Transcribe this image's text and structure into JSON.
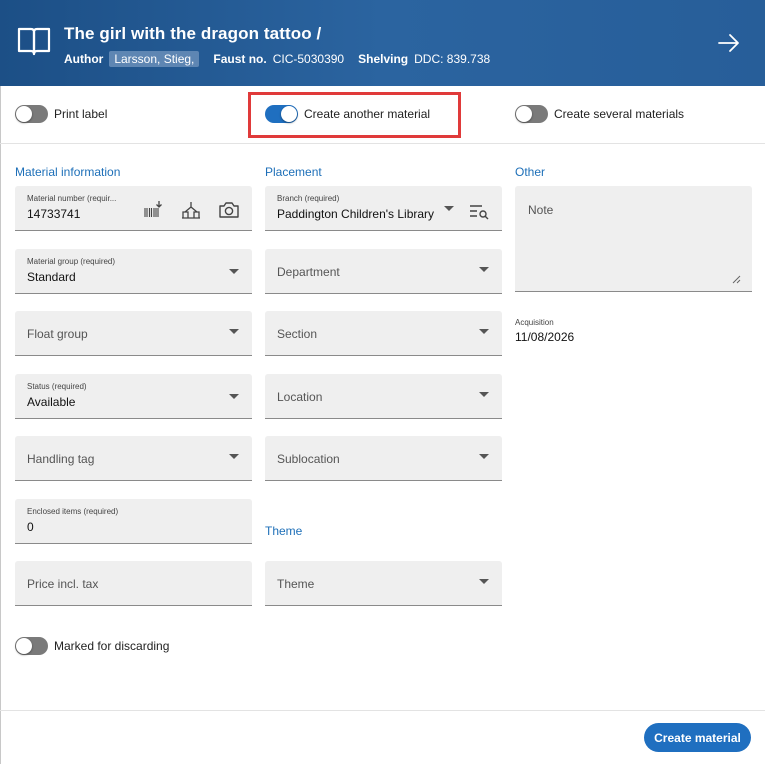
{
  "header": {
    "title": "The girl with the dragon tattoo /",
    "author_label": "Author",
    "author_value": "Larsson, Stieg,",
    "faust_label": "Faust no.",
    "faust_value": "CIC-5030390",
    "shelving_label": "Shelving",
    "shelving_value": "DDC: 839.738"
  },
  "toggles": {
    "print_label": "Print label",
    "create_another": "Create another material",
    "create_several": "Create several materials",
    "marked_discarding": "Marked for discarding"
  },
  "sections": {
    "material_info": "Material information",
    "placement": "Placement",
    "other": "Other",
    "theme": "Theme"
  },
  "fields": {
    "material_number": {
      "label": "Material number (requir...",
      "value": "14733741"
    },
    "material_group": {
      "label": "Material group (required)",
      "value": "Standard"
    },
    "float_group": {
      "placeholder": "Float group"
    },
    "status": {
      "label": "Status (required)",
      "value": "Available"
    },
    "handling_tag": {
      "placeholder": "Handling tag"
    },
    "enclosed_items": {
      "label": "Enclosed items (required)",
      "value": "0"
    },
    "price": {
      "placeholder": "Price incl. tax"
    },
    "branch": {
      "label": "Branch (required)",
      "value": "Paddington Children's Library"
    },
    "department": {
      "placeholder": "Department"
    },
    "section": {
      "placeholder": "Section"
    },
    "location": {
      "placeholder": "Location"
    },
    "sublocation": {
      "placeholder": "Sublocation"
    },
    "theme": {
      "placeholder": "Theme"
    },
    "note": {
      "placeholder": "Note"
    },
    "acquisition": {
      "label": "Acquisition",
      "value": "11/08/2026"
    }
  },
  "footer": {
    "create_button": "Create material"
  },
  "colors": {
    "header_bg": "#2b64a0",
    "accent": "#1f6fc0",
    "highlight": "#e03a3a"
  }
}
